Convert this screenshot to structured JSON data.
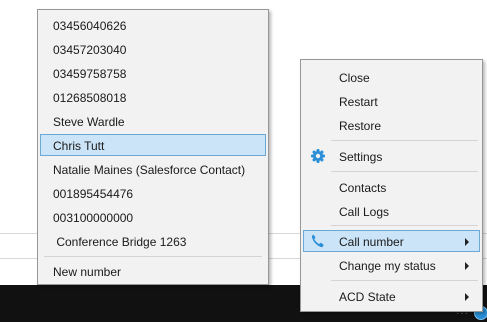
{
  "contact_menu": {
    "items": [
      {
        "label": "03456040626"
      },
      {
        "label": "03457203040"
      },
      {
        "label": "03459758758"
      },
      {
        "label": "01268508018"
      },
      {
        "label": "Steve Wardle"
      },
      {
        "label": "Chris Tutt",
        "highlighted": true
      },
      {
        "label": "Natalie Maines (Salesforce Contact)"
      },
      {
        "label": "001895454476"
      },
      {
        "label": "003100000000"
      },
      {
        "label": " Conference Bridge 1263"
      }
    ],
    "new_number_label": "New number"
  },
  "tray_menu": {
    "close_label": "Close",
    "restart_label": "Restart",
    "restore_label": "Restore",
    "settings_label": "Settings",
    "contacts_label": "Contacts",
    "call_logs_label": "Call Logs",
    "call_number_label": "Call number",
    "change_status_label": "Change my status",
    "acd_state_label": "ACD State"
  },
  "icons": {
    "settings": "gear-icon",
    "call_number": "phone-icon",
    "submenu": "chevron-right-icon"
  },
  "colors": {
    "highlight_bg": "#cce4f7",
    "highlight_border": "#6aa8d8",
    "icon_blue": "#2a8fd6"
  }
}
